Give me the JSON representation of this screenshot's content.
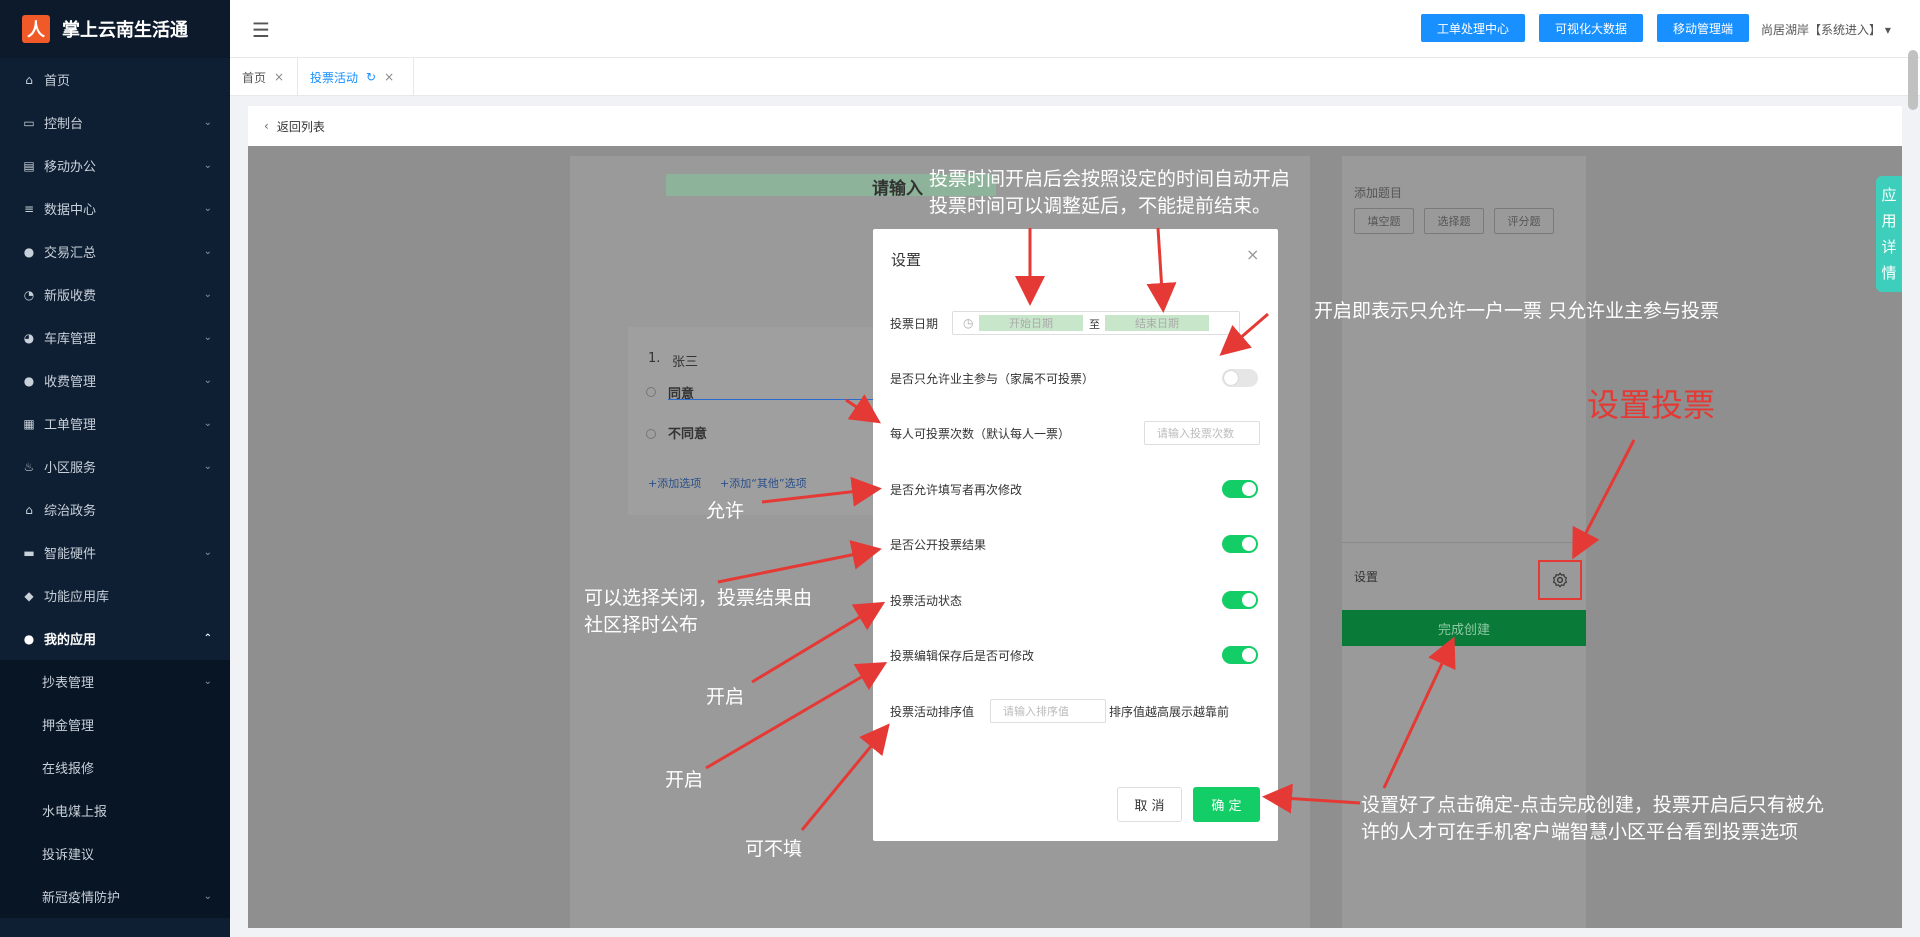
{
  "app": {
    "title": "掌上云南生活通",
    "logo_glyph": "人"
  },
  "sidebar": {
    "items": [
      {
        "label": "首页",
        "icon": "home-icon",
        "glyph": "⌂",
        "has_children": false
      },
      {
        "label": "控制台",
        "icon": "monitor-icon",
        "glyph": "▭",
        "has_children": true
      },
      {
        "label": "移动办公",
        "icon": "briefcase-icon",
        "glyph": "▤",
        "has_children": true
      },
      {
        "label": "数据中心",
        "icon": "database-icon",
        "glyph": "≡",
        "has_children": true
      },
      {
        "label": "交易汇总",
        "icon": "moneybag-icon",
        "glyph": "●",
        "has_children": true
      },
      {
        "label": "新版收费",
        "icon": "pie-icon",
        "glyph": "◔",
        "has_children": true
      },
      {
        "label": "车库管理",
        "icon": "car-icon",
        "glyph": "◕",
        "has_children": true
      },
      {
        "label": "收费管理",
        "icon": "moneybag-icon",
        "glyph": "●",
        "has_children": true
      },
      {
        "label": "工单管理",
        "icon": "document-icon",
        "glyph": "▦",
        "has_children": true
      },
      {
        "label": "小区服务",
        "icon": "service-icon",
        "glyph": "♨",
        "has_children": true
      },
      {
        "label": "综治政务",
        "icon": "government-icon",
        "glyph": "⌂",
        "has_children": false
      },
      {
        "label": "智能硬件",
        "icon": "hardware-icon",
        "glyph": "▬",
        "has_children": true
      },
      {
        "label": "功能应用库",
        "icon": "cube-icon",
        "glyph": "◆",
        "has_children": false
      },
      {
        "label": "我的应用",
        "icon": "user-icon",
        "glyph": "●",
        "has_children": true,
        "expanded": true
      }
    ],
    "submenu": [
      {
        "label": "抄表管理",
        "has_children": true
      },
      {
        "label": "押金管理",
        "has_children": false
      },
      {
        "label": "在线报修",
        "has_children": false
      },
      {
        "label": "水电煤上报",
        "has_children": false
      },
      {
        "label": "投诉建议",
        "has_children": false
      },
      {
        "label": "新冠疫情防护",
        "has_children": true
      }
    ]
  },
  "topbar": {
    "buttons": [
      "工单处理中心",
      "可视化大数据",
      "移动管理端"
    ],
    "user": "尚居湖岸【系统进入】 ▾"
  },
  "tabs": [
    {
      "label": "首页",
      "active": false
    },
    {
      "label": "投票活动",
      "active": true
    }
  ],
  "back": {
    "label": "返回列表"
  },
  "app_detail": [
    "应",
    "用",
    "详",
    "情"
  ],
  "editor": {
    "title_text": "请输入",
    "question": {
      "number": "1.",
      "title": "张三",
      "options": [
        "同意",
        "不同意"
      ]
    },
    "add_option": "+添加选项",
    "add_other": "+添加“其他”选项"
  },
  "right_panel": {
    "add_label": "添加题目",
    "buttons": [
      "填空题",
      "选择题",
      "评分题"
    ],
    "settings_label": "设置",
    "finish": "完成创建"
  },
  "modal": {
    "title": "设置",
    "close": "×",
    "vote_date": {
      "label": "投票日期",
      "start": "开始日期",
      "sep": "至",
      "end": "结束日期"
    },
    "owner_only": {
      "label": "是否只允许业主参与（家属不可投票）",
      "on": false
    },
    "vote_count": {
      "label": "每人可投票次数（默认每人一票）",
      "placeholder": "请输入投票次数"
    },
    "allow_modify": {
      "label": "是否允许填写者再次修改",
      "on": true
    },
    "public_result": {
      "label": "是否公开投票结果",
      "on": true
    },
    "activity_status": {
      "label": "投票活动状态",
      "on": true
    },
    "editable_after_save": {
      "label": "投票编辑保存后是否可修改",
      "on": true
    },
    "sort": {
      "label": "投票活动排序值",
      "placeholder": "请输入排序值",
      "note": "排序值越高展示越靠前"
    },
    "cancel": "取 消",
    "ok": "确 定"
  },
  "annotations": {
    "time_line1": "投票时间开启后会按照设定的时间自动开启",
    "time_line2": "投票时间可以调整延后，不能提前结束。",
    "owner_only": "开启即表示只允许一户一票 只允许业主参与投票",
    "set_vote": "设置投票",
    "allow": "允许",
    "close_line1": "可以选择关闭，投票结果由",
    "close_line2": "社区择时公布",
    "open1": "开启",
    "open2": "开启",
    "optional": "可不填",
    "confirm_line1": "设置好了点击确定-点击完成创建，投票开启后只有被允",
    "confirm_line2": "许的人才可在手机客户端智慧小区平台看到投票选项"
  },
  "colors": {
    "primary": "#1890ff",
    "success": "#13ce66",
    "annotation": "#e53935",
    "sidebar_bg": "#0f1f33"
  }
}
